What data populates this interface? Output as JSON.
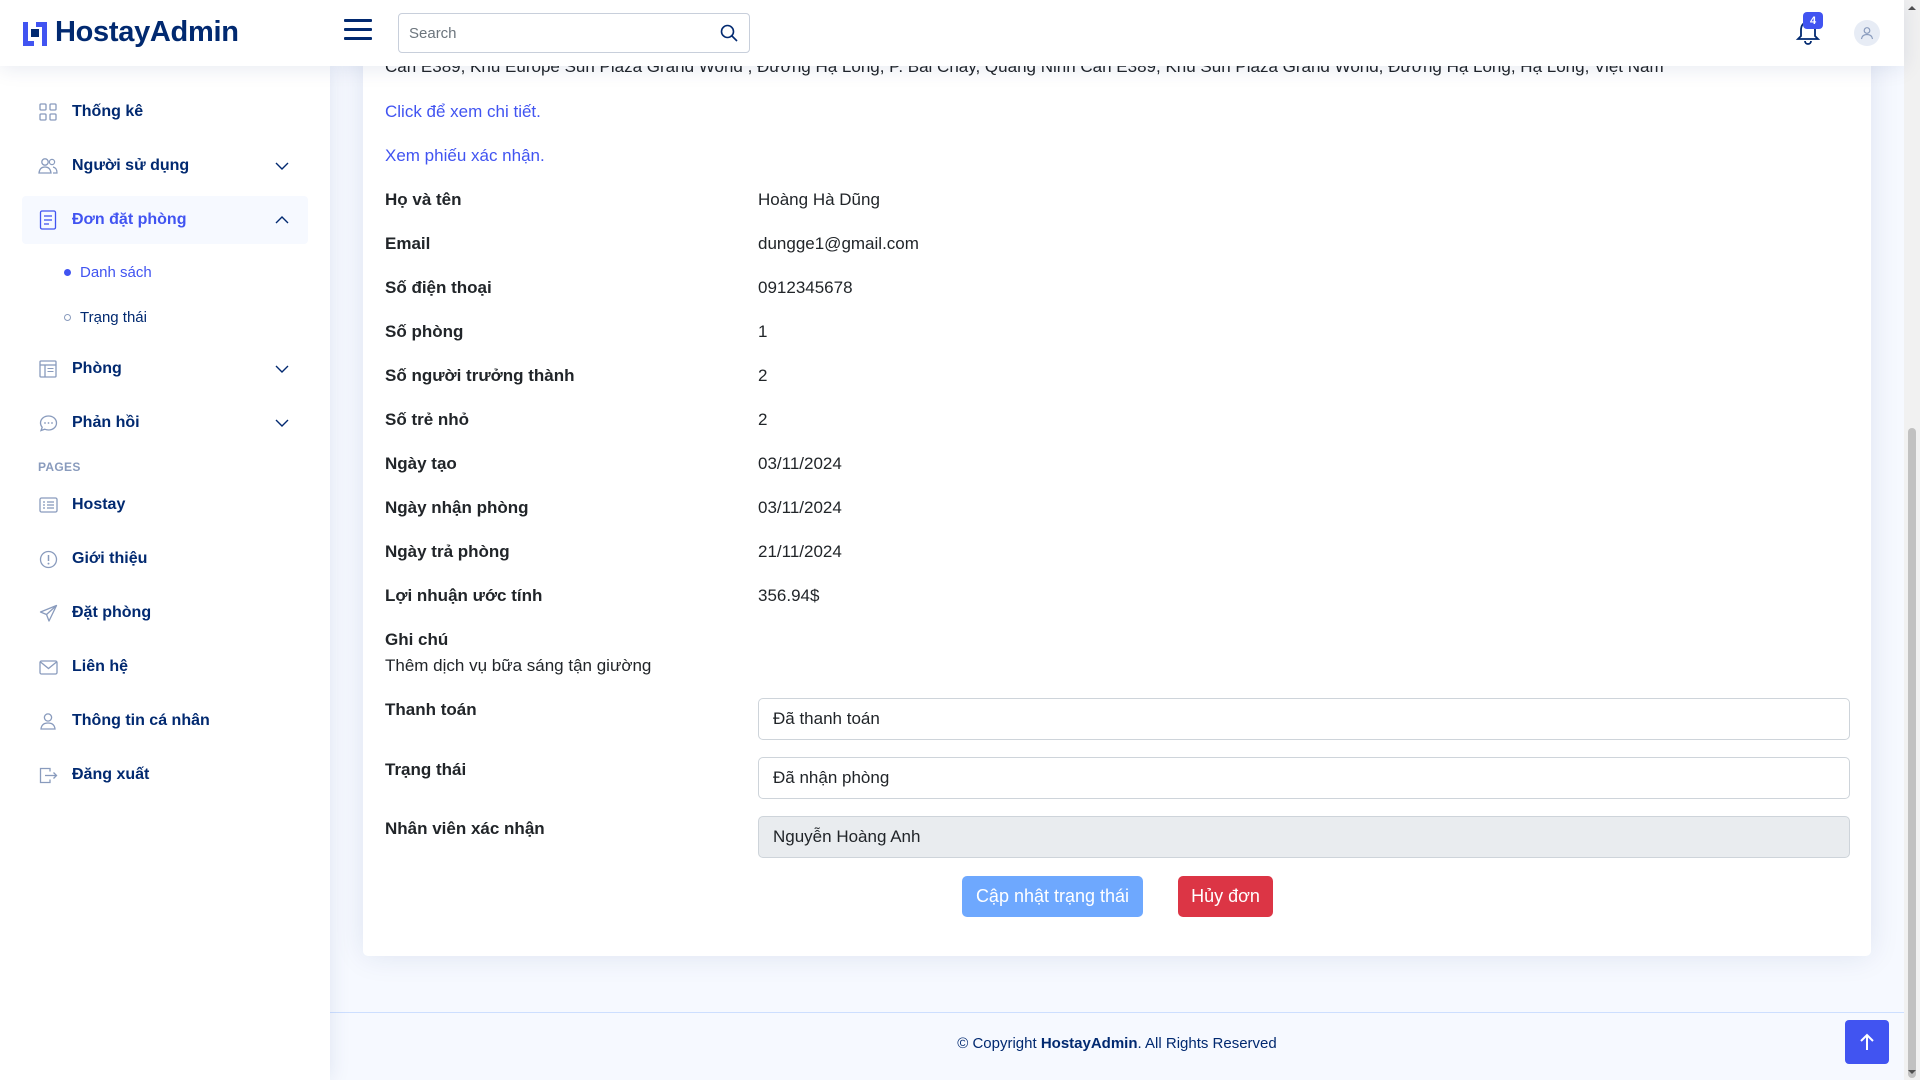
{
  "app": {
    "logo_text": "HostayAdmin"
  },
  "header": {
    "search_placeholder": "Search",
    "notification_count": "4"
  },
  "sidebar": {
    "items": [
      {
        "label": "Thống kê",
        "icon": "grid-icon"
      },
      {
        "label": "Người sử dụng",
        "icon": "users-icon"
      },
      {
        "label": "Đơn đặt phòng",
        "icon": "receipt-icon"
      },
      {
        "label": "Phòng",
        "icon": "layout-icon"
      },
      {
        "label": "Phản hồi",
        "icon": "chat-icon"
      }
    ],
    "sub_items": [
      {
        "label": "Danh sách"
      },
      {
        "label": "Trạng thái"
      }
    ],
    "pages_heading": "PAGES",
    "pages": [
      {
        "label": "Hostay",
        "icon": "card-list-icon"
      },
      {
        "label": "Giới thiệu",
        "icon": "info-circle-icon"
      },
      {
        "label": "Đặt phòng",
        "icon": "send-icon"
      },
      {
        "label": "Liên hệ",
        "icon": "envelope-icon"
      },
      {
        "label": "Thông tin cá nhân",
        "icon": "person-icon"
      },
      {
        "label": "Đăng xuất",
        "icon": "logout-icon"
      }
    ]
  },
  "booking": {
    "address": "Căn E389, Khu Europe Sun Plaza Grand World , Đường Hạ Long, P. Bãi Cháy, Quảng Ninh Căn E389, Khu Sun Plaza Grand World, Đường Hạ Long, Hạ Long, Việt Nam",
    "link_details": "Click để xem chi tiết.",
    "link_confirm": "Xem phiếu xác nhận.",
    "rows": [
      {
        "label": "Họ và tên",
        "value": "Hoàng Hà Dũng"
      },
      {
        "label": "Email",
        "value": "dungge1@gmail.com"
      },
      {
        "label": "Số điện thoại",
        "value": "0912345678"
      },
      {
        "label": "Số phòng",
        "value": "1"
      },
      {
        "label": "Số người trưởng thành",
        "value": "2"
      },
      {
        "label": "Số trẻ nhỏ",
        "value": "2"
      },
      {
        "label": "Ngày tạo",
        "value": "03/11/2024"
      },
      {
        "label": "Ngày nhận phòng",
        "value": "03/11/2024"
      },
      {
        "label": "Ngày trả phòng",
        "value": "21/11/2024"
      },
      {
        "label": "Lợi nhuận ước tính",
        "value": "356.94$"
      }
    ],
    "note_label": "Ghi chú",
    "note_value": "Thêm dịch vụ bữa sáng tận giường",
    "payment_label": "Thanh toán",
    "payment_value": "Đã thanh toán",
    "status_label": "Trạng thái",
    "status_value": "Đã nhận phòng",
    "staff_label": "Nhân viên xác nhận",
    "staff_value": "Nguyễn Hoàng Anh",
    "update_button": "Cập nhật trạng thái",
    "cancel_button": "Hủy đơn"
  },
  "footer": {
    "prefix": "© Copyright ",
    "brand": "HostayAdmin",
    "suffix": ". All Rights Reserved"
  },
  "colors": {
    "primary": "#4154f1",
    "navy": "#012970",
    "danger": "#dc3545",
    "light_primary": "#6ea8fe"
  }
}
